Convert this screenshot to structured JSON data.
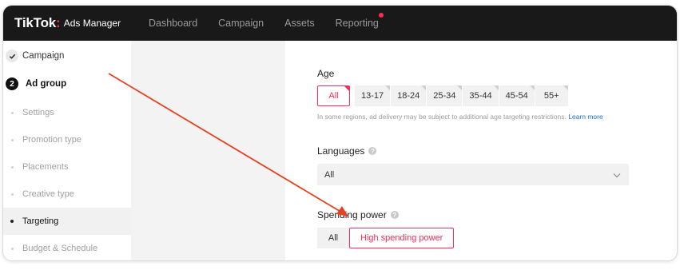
{
  "brand": {
    "name": "TikTok",
    "product": "Ads Manager"
  },
  "nav": [
    "Dashboard",
    "Campaign",
    "Assets",
    "Reporting"
  ],
  "sidebar": {
    "campaign": "Campaign",
    "adgroup_number": "2",
    "adgroup": "Ad group",
    "items": [
      "Settings",
      "Promotion type",
      "Placements",
      "Creative type",
      "Targeting",
      "Budget & Schedule"
    ]
  },
  "age": {
    "label": "Age",
    "options": [
      "All",
      "13-17",
      "18-24",
      "25-34",
      "35-44",
      "45-54",
      "55+"
    ],
    "selected": "All",
    "hint": "In some regions, ad delivery may be subject to additional age targeting restrictions.",
    "learn_more": "Learn more"
  },
  "languages": {
    "label": "Languages",
    "value": "All"
  },
  "spending_power": {
    "label": "Spending power",
    "options": [
      "All",
      "High spending power"
    ],
    "selected": "High spending power"
  },
  "colors": {
    "accent": "#fe2c55",
    "topbar": "#191919",
    "arrow": "#e8411f",
    "link": "#1a73c8"
  },
  "icons": [
    "check-icon",
    "help-icon",
    "chevron-down-icon",
    "notification-dot",
    "annotation-arrow"
  ]
}
